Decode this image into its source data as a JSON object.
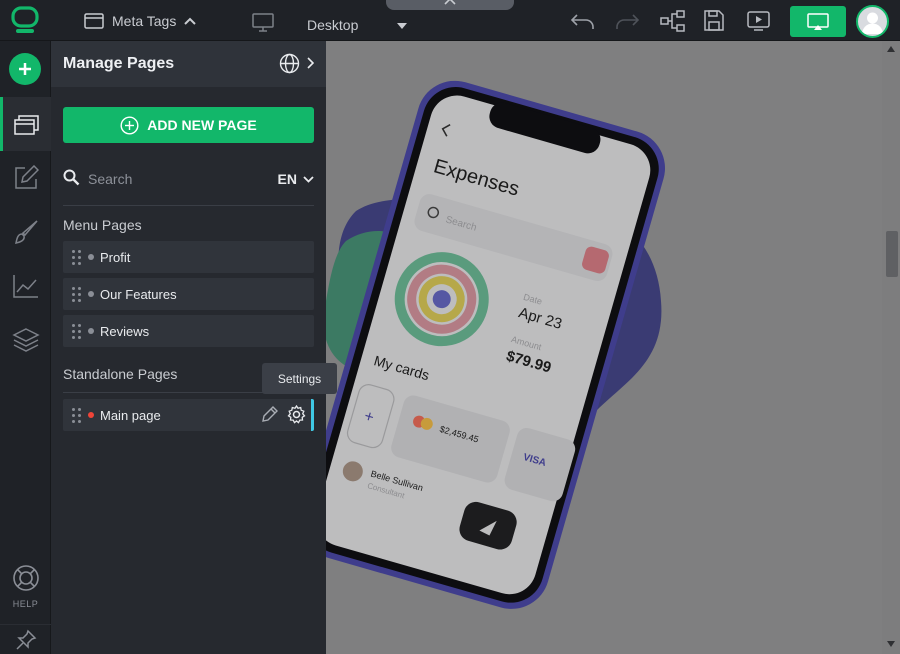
{
  "header": {
    "meta_tags_label": "Meta Tags",
    "device_label": "Desktop"
  },
  "rail": {
    "help_label": "HELP"
  },
  "panel": {
    "title": "Manage Pages",
    "add_button_label": "ADD NEW PAGE",
    "search_placeholder": "Search",
    "language": "EN",
    "menu_section_title": "Menu Pages",
    "menu_pages": [
      {
        "label": "Profit"
      },
      {
        "label": "Our Features"
      },
      {
        "label": "Reviews"
      }
    ],
    "standalone_section_title": "Standalone Pages",
    "standalone_pages": [
      {
        "label": "Main page"
      }
    ],
    "tooltip": "Settings"
  },
  "canvas": {
    "screen_title": "Expenses",
    "search_placeholder": "Search",
    "date_label": "Date",
    "date_value": "Apr 23",
    "amount_label": "Amount",
    "amount_value": "$79.99",
    "cards_title": "My cards",
    "card_amount": "$2,459.45",
    "card_brand": "VISA",
    "contact_name": "Belle Sullivan",
    "contact_role": "Consultant"
  },
  "colors": {
    "accent": "#12b76a",
    "selected_marker": "#3fc8e4",
    "canvas_overlay": "#7f7f80"
  }
}
